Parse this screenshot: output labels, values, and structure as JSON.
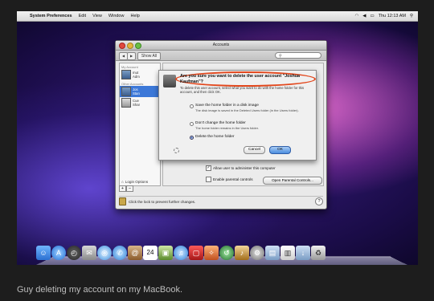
{
  "menubar": {
    "app": "System Preferences",
    "items": [
      "Edit",
      "View",
      "Window",
      "Help"
    ],
    "clock": "Thu 12:13 AM"
  },
  "window": {
    "title": "Accounts",
    "show_all": "Show All",
    "nav_back": "◀",
    "nav_fwd": "▶",
    "search_icon": "search-icon"
  },
  "sidebar": {
    "my_account_header": "My Account",
    "other_accounts_header": "Other Accounts",
    "users": [
      {
        "name": "mut",
        "role": "Adm"
      },
      {
        "name": "Jos",
        "role": "Stan"
      },
      {
        "name": "",
        "role": ""
      },
      {
        "name": "Cue",
        "role": "Shar"
      }
    ],
    "login_options": "Login Options",
    "add": "+",
    "remove": "–"
  },
  "main": {
    "allow_admin": "Allow user to administer this computer",
    "parental": "Enable parental controls",
    "parental_btn": "Open Parental Controls..."
  },
  "lock": {
    "text": "Click the lock to prevent further changes."
  },
  "sheet": {
    "title": "Are you sure you want to delete the user account \"Joshua Kaufman\"?",
    "body": "To delete this user account, select what you want to do with the home folder for this account, and then click OK.",
    "options": [
      {
        "label": "Save the home folder in a disk image",
        "desc": "The disk image is saved in the Deleted Users folder (in the Users folder).",
        "selected": false
      },
      {
        "label": "Don't change the home folder",
        "desc": "The home folder remains in the Users folder.",
        "selected": false
      },
      {
        "label": "Delete the home folder",
        "desc": "",
        "selected": true
      }
    ],
    "cancel": "Cancel",
    "ok": "OK"
  },
  "dock": {
    "icons": [
      "finder-icon",
      "app-store-icon",
      "dashboard-icon",
      "mail-icon",
      "safari-icon",
      "ichat-icon",
      "address-book-icon",
      "ical-icon",
      "iphoto-icon",
      "itunes-icon",
      "photo-booth-icon",
      "iphoto-2-icon",
      "time-machine-icon",
      "garageband-icon",
      "system-preferences-icon",
      "applications-icon",
      "documents-icon",
      "downloads-icon",
      "trash-icon"
    ]
  },
  "caption": "Guy deleting my account on my MacBook."
}
